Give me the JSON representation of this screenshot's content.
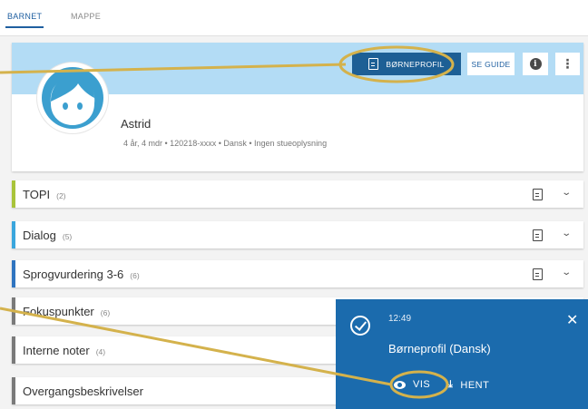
{
  "tabs": [
    {
      "label": "BARNET",
      "active": true
    },
    {
      "label": "MAPPE",
      "active": false
    }
  ],
  "profile": {
    "primary_button_label": "BØRNEPROFIL",
    "guide_button_label": "SE GUIDE",
    "info_label": "i",
    "more_label": "⋮",
    "name": "Astrid",
    "meta": "4 år, 4 mdr • 120218-xxxx • Dansk • Ingen stueoplysning"
  },
  "sections": [
    {
      "title": "TOPI",
      "count": "(2)",
      "color": "#a9c43a",
      "has_doc": true
    },
    {
      "title": "Dialog",
      "count": "(5)",
      "color": "#3aa6dd",
      "has_doc": true
    },
    {
      "title": "Sprogvurdering 3-6",
      "count": "(6)",
      "color": "#2f74c0",
      "has_doc": true
    },
    {
      "title": "Fokuspunkter",
      "count": "(6)",
      "color": "#7a7a7a",
      "has_doc": false
    },
    {
      "title": "Interne noter",
      "count": "(4)",
      "color": "#7a7a7a",
      "has_doc": false
    },
    {
      "title": "Overgangsbeskrivelser",
      "count": "",
      "color": "#7a7a7a",
      "has_doc": false
    }
  ],
  "toast": {
    "time": "12:49",
    "message": "Børneprofil (Dansk)",
    "view_label": "VIS",
    "download_label": "HENT",
    "close_label": "✕"
  },
  "colors": {
    "accent": "#1d5f95",
    "banner": "#b3dcf5",
    "toast": "#1b6bad",
    "highlight": "#d4b24c"
  },
  "icons": {
    "doc": "document-icon",
    "chevron": "chevron-down-icon",
    "check": "check-circle-icon",
    "eye": "eye-icon",
    "download": "download-icon",
    "close": "close-icon",
    "info": "info-icon",
    "more": "more-vertical-icon"
  }
}
